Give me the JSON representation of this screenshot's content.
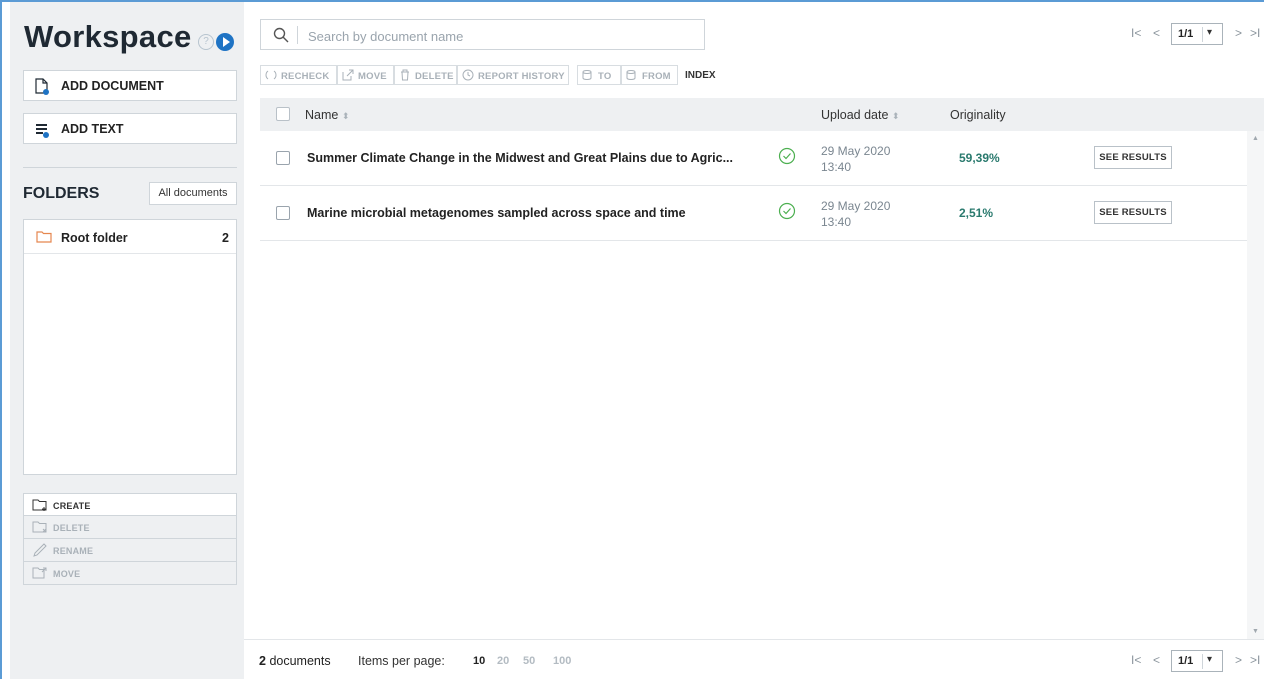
{
  "sidebar": {
    "title": "Workspace",
    "help_glyph": "?",
    "add_document_label": "ADD DOCUMENT",
    "add_text_label": "ADD TEXT",
    "folders_heading": "FOLDERS",
    "all_documents_label": "All documents",
    "folders": [
      {
        "name": "Root folder",
        "count": "2"
      }
    ],
    "folder_actions": [
      {
        "label": "CREATE",
        "enabled": true
      },
      {
        "label": "DELETE",
        "enabled": false
      },
      {
        "label": "RENAME",
        "enabled": false
      },
      {
        "label": "MOVE",
        "enabled": false
      }
    ]
  },
  "search": {
    "placeholder": "Search by document name",
    "value": ""
  },
  "pagination": {
    "current": "1/1",
    "first_glyph": "I<",
    "prev_glyph": "<",
    "next_glyph": ">",
    "last_glyph": ">I"
  },
  "toolbar": {
    "recheck": "RECHECK",
    "move": "MOVE",
    "delete": "DELETE",
    "report_history": "REPORT HISTORY",
    "to": "TO",
    "from": "FROM",
    "index": "INDEX"
  },
  "table": {
    "headers": {
      "name": "Name",
      "upload_date": "Upload date",
      "originality": "Originality"
    },
    "rows": [
      {
        "name": "Summer Climate Change in the Midwest and Great Plains due to Agric...",
        "date": "29 May 2020",
        "time": "13:40",
        "originality": "59,39%",
        "action": "SEE RESULTS"
      },
      {
        "name": "Marine microbial metagenomes sampled across space and time",
        "date": "29 May 2020",
        "time": "13:40",
        "originality": "2,51%",
        "action": "SEE RESULTS"
      }
    ]
  },
  "footer": {
    "count_number": "2",
    "count_label": "documents",
    "items_per_page_label": "Items per page:",
    "options": [
      "10",
      "20",
      "50",
      "100"
    ],
    "selected_option": "10"
  },
  "colors": {
    "accent_blue": "#1e73c4",
    "folder_orange": "#e5874f",
    "check_green": "#4caf50",
    "originality_teal": "#2a7a6e"
  }
}
